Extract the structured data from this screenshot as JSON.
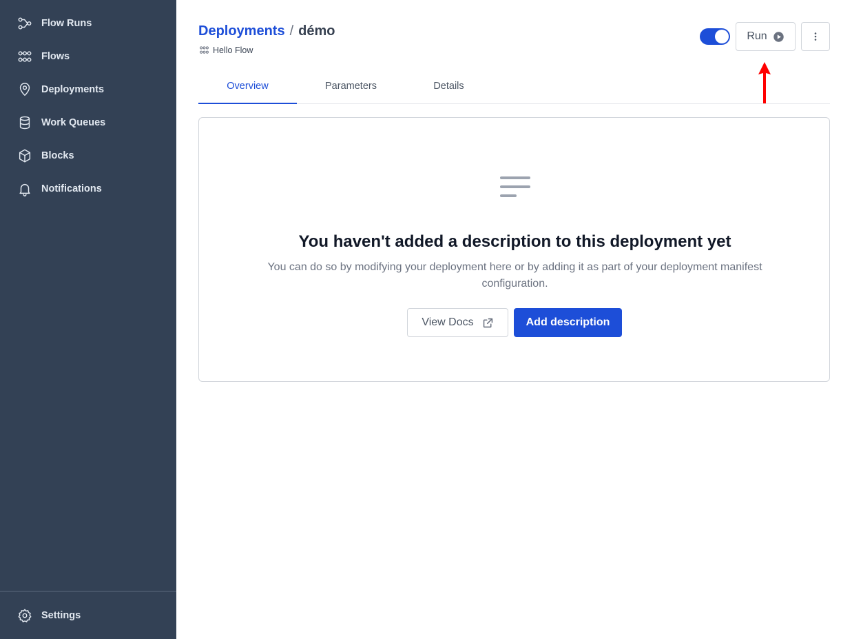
{
  "sidebar": {
    "items": [
      {
        "label": "Flow Runs",
        "icon": "flow-runs-icon"
      },
      {
        "label": "Flows",
        "icon": "flows-icon"
      },
      {
        "label": "Deployments",
        "icon": "location-pin-icon"
      },
      {
        "label": "Work Queues",
        "icon": "database-icon"
      },
      {
        "label": "Blocks",
        "icon": "cube-icon"
      },
      {
        "label": "Notifications",
        "icon": "bell-icon"
      }
    ],
    "settings": {
      "label": "Settings",
      "icon": "gear-icon"
    }
  },
  "header": {
    "breadcrumb_link": "Deployments",
    "separator": "/",
    "current": "démo",
    "flow_name": "Hello Flow",
    "toggle_on": true,
    "run_label": "Run"
  },
  "tabs": [
    {
      "label": "Overview",
      "active": true
    },
    {
      "label": "Parameters",
      "active": false
    },
    {
      "label": "Details",
      "active": false
    }
  ],
  "empty_state": {
    "title": "You haven't added a description to this deployment yet",
    "message": "You can do so by modifying your deployment here or by adding it as part of your deployment manifest configuration.",
    "view_docs_label": "View Docs",
    "add_description_label": "Add description"
  },
  "colors": {
    "sidebar_bg": "#334155",
    "accent": "#1d4ed8",
    "annotation_arrow": "#ff0000"
  }
}
